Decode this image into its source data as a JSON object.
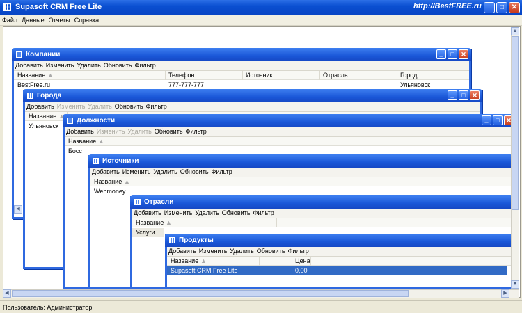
{
  "app": {
    "title": "Supasoft CRM Free Lite",
    "site": "http://BestFREE.ru"
  },
  "menu": [
    "Файл",
    "Данные",
    "Отчеты",
    "Справка"
  ],
  "status": "Пользователь: Администратор",
  "toolbar": {
    "add": "Добавить",
    "edit": "Изменить",
    "del": "Удалить",
    "refresh": "Обновить",
    "filter": "Фильтр"
  },
  "companies": {
    "title": "Компании",
    "cols": [
      "Название",
      "Телефон",
      "Источник",
      "Отрасль",
      "Город"
    ],
    "row": {
      "name": "BestFree.ru",
      "phone": "777-777-777",
      "source": "",
      "industry": "",
      "city": "Ульяновск"
    }
  },
  "cities": {
    "title": "Города",
    "col": "Название",
    "row": "Ульяновск"
  },
  "positions": {
    "title": "Должности",
    "col": "Название",
    "row": "Босс"
  },
  "sources": {
    "title": "Источники",
    "col": "Название",
    "row": "Webmoney"
  },
  "industries": {
    "title": "Отрасли",
    "col": "Название",
    "row": "Услуги"
  },
  "products": {
    "title": "Продукты",
    "cols": [
      "Название",
      "Цена"
    ],
    "row": {
      "name": "Supasoft CRM Free Lite",
      "price": "0,00"
    }
  }
}
